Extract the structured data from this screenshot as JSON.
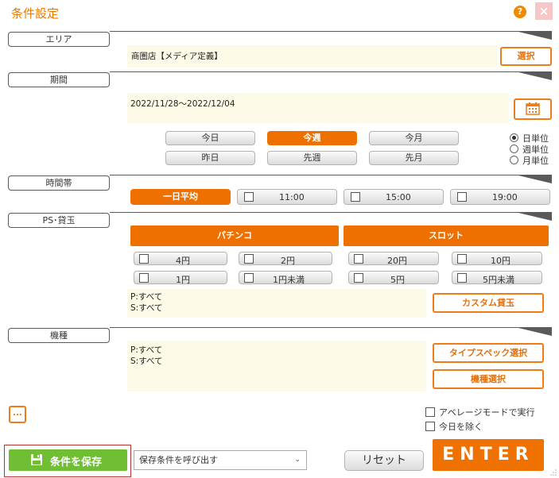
{
  "window": {
    "title": "条件設定",
    "help_label": "?",
    "close_label": "×"
  },
  "sections": {
    "area": {
      "label": "エリア",
      "value": "商圏店【メディア定義】",
      "select_label": "選択"
    },
    "period": {
      "label": "期間",
      "value": "2022/11/28〜2022/12/04",
      "buttons_row1": [
        "今日",
        "今週",
        "今月"
      ],
      "buttons_row2": [
        "昨日",
        "先週",
        "先月"
      ],
      "active_button": "今週",
      "units": [
        {
          "label": "日単位",
          "selected": true
        },
        {
          "label": "週単位",
          "selected": false
        },
        {
          "label": "月単位",
          "selected": false
        }
      ]
    },
    "timeband": {
      "label": "時間帯",
      "daily_avg_label": "一日平均",
      "times": [
        "11:00",
        "15:00",
        "19:00"
      ]
    },
    "ps": {
      "label": "PS･貸玉",
      "pachinko_label": "パチンコ",
      "slot_label": "スロット",
      "pachinko_row1": [
        "4円",
        "2円"
      ],
      "pachinko_row2": [
        "1円",
        "1円未満"
      ],
      "slot_row1": [
        "20円",
        "10円"
      ],
      "slot_row2": [
        "5円",
        "5円未満"
      ],
      "summary_p": "P:すべて",
      "summary_s": "S:すべて",
      "custom_label": "カスタム貸玉"
    },
    "model": {
      "label": "機種",
      "summary_p": "P:すべて",
      "summary_s": "S:すべて",
      "type_spec_label": "タイプスペック選択",
      "model_select_label": "機種選択"
    }
  },
  "footer": {
    "more_label": "...",
    "average_mode_label": "アベレージモードで実行",
    "exclude_today_label": "今日を除く",
    "save_label": "条件を保存",
    "load_placeholder": "保存条件を呼び出す",
    "reset_label": "リセット",
    "enter_label": "ENTER"
  },
  "colors": {
    "accent": "#ee7000",
    "save_green": "#6fbe33",
    "panel_bg": "#fdfbe8"
  }
}
